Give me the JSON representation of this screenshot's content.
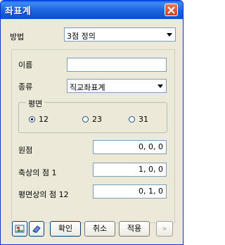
{
  "window": {
    "title": "좌표계"
  },
  "method": {
    "label": "방법",
    "value": "3점 정의"
  },
  "name": {
    "label": "이름",
    "value": ""
  },
  "type": {
    "label": "종류",
    "value": "직교좌표계"
  },
  "plane": {
    "title": "평면",
    "options": [
      "12",
      "23",
      "31"
    ],
    "selected": "12"
  },
  "origin": {
    "label": "원점",
    "value": "0, 0, 0"
  },
  "axis_point": {
    "label": "축상의 점 1",
    "value": "1, 0, 0"
  },
  "plane_point": {
    "label": "평면상의 점 12",
    "value": "0, 1, 0"
  },
  "buttons": {
    "ok": "확인",
    "cancel": "취소",
    "apply": "적용",
    "more": "»"
  },
  "icons": [
    "picture-icon",
    "eraser-icon",
    "close-icon"
  ]
}
